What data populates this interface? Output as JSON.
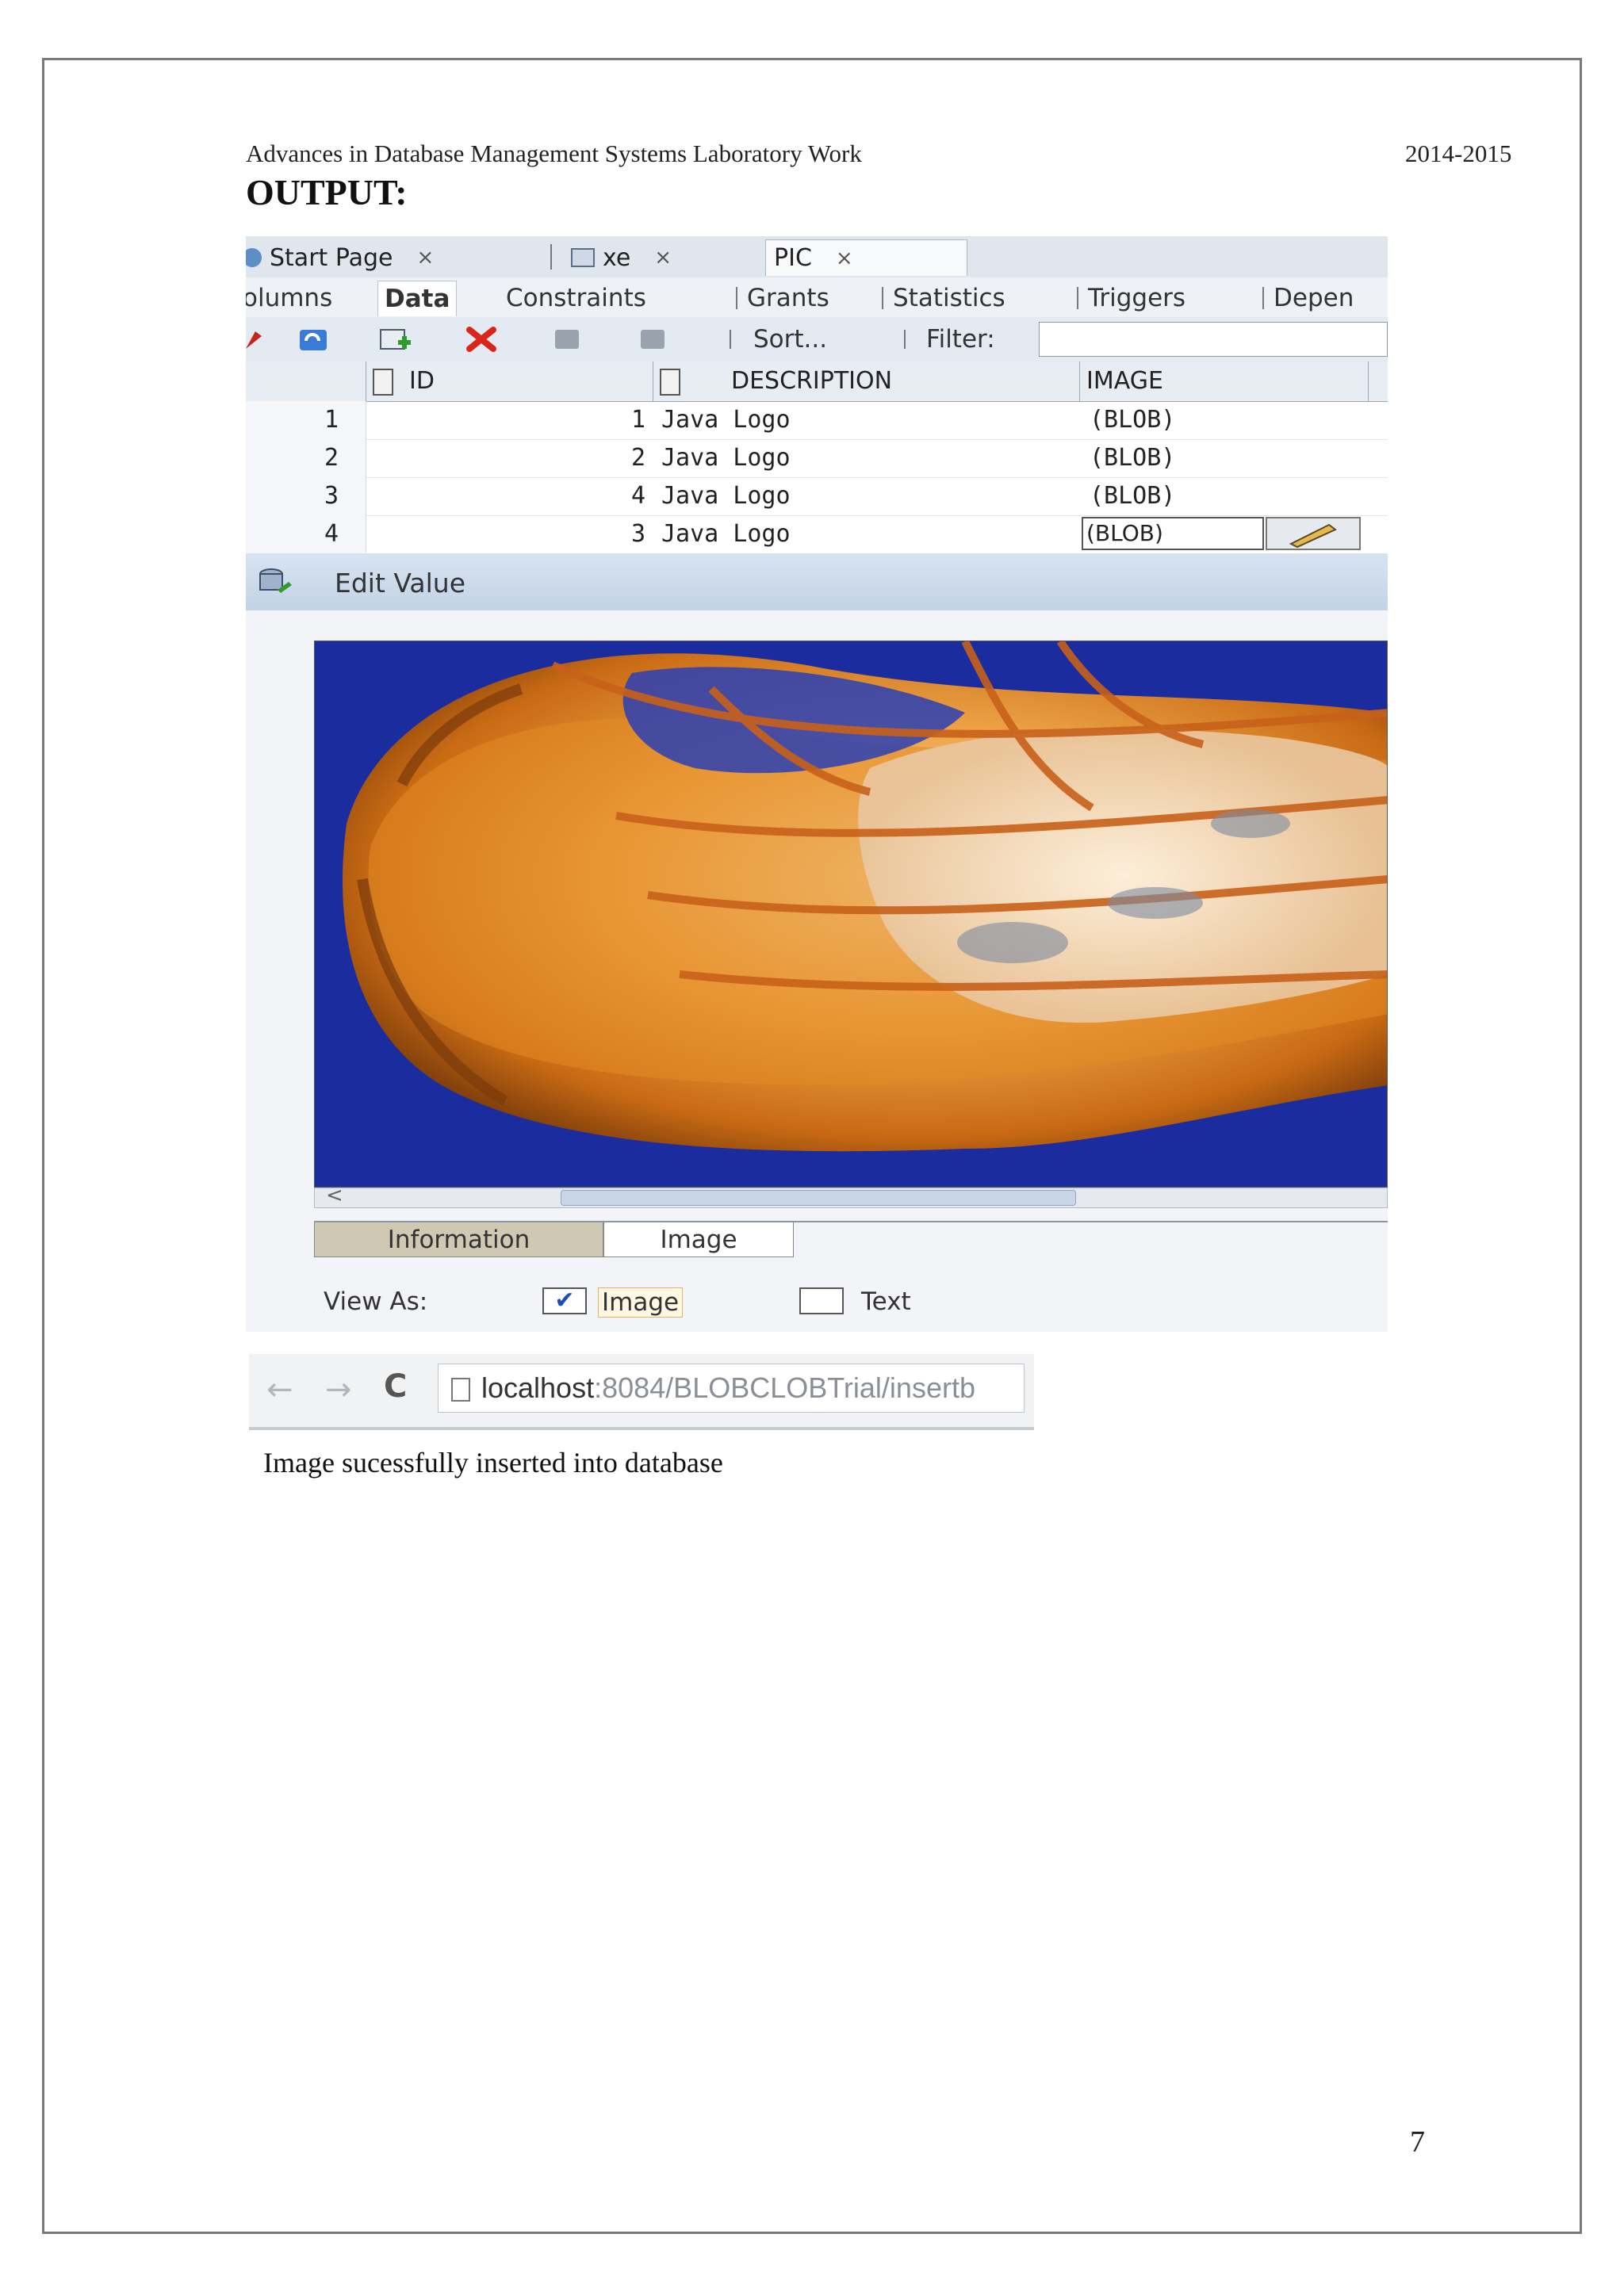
{
  "header": {
    "left": "Advances in Database Management Systems Laboratory Work",
    "right": "2014-2015"
  },
  "section_title": "OUTPUT:",
  "sql_developer": {
    "document_tabs": [
      {
        "label": "Start Page",
        "close": "×"
      },
      {
        "label": "xe",
        "close": "×"
      },
      {
        "label": "PIC",
        "close": "×"
      }
    ],
    "sub_tabs": [
      "olumns",
      "Data",
      "Constraints",
      "Grants",
      "Statistics",
      "Triggers",
      "Depen"
    ],
    "active_sub_tab": "Data",
    "toolbar": {
      "sort_label": "Sort...",
      "filter_label": "Filter:",
      "filter_value": ""
    },
    "grid": {
      "columns": [
        "ID",
        "DESCRIPTION",
        "IMAGE"
      ],
      "rows": [
        {
          "row": "1",
          "id": "1",
          "description": "Java Logo",
          "image": "(BLOB)"
        },
        {
          "row": "2",
          "id": "2",
          "description": "Java Logo",
          "image": "(BLOB)"
        },
        {
          "row": "3",
          "id": "4",
          "description": "Java Logo",
          "image": "(BLOB)"
        },
        {
          "row": "4",
          "id": "3",
          "description": "Java Logo",
          "image": "(BLOB)"
        }
      ]
    },
    "edit_value": {
      "title": "Edit Value",
      "bottom_tabs": [
        "Information",
        "Image"
      ],
      "view_as_label": "View As:",
      "options": [
        {
          "label": "Image",
          "checked": true
        },
        {
          "label": "Text",
          "checked": false
        }
      ],
      "image_description": "jellyfish photo on deep blue background",
      "scroll_left_arrow": "<"
    }
  },
  "browser": {
    "back": "←",
    "forward": "→",
    "reload": "C",
    "url_host": "localhost",
    "url_path": ":8084/BLOBCLOBTrial/insertb"
  },
  "result_message": "Image sucessfully inserted into database",
  "page_number": "7",
  "colors": {
    "image_background": "#1b2d9e",
    "jellyfish_orange": "#d9801e",
    "delete_red": "#d8261c",
    "filter_blue": "#3a7bd5"
  }
}
